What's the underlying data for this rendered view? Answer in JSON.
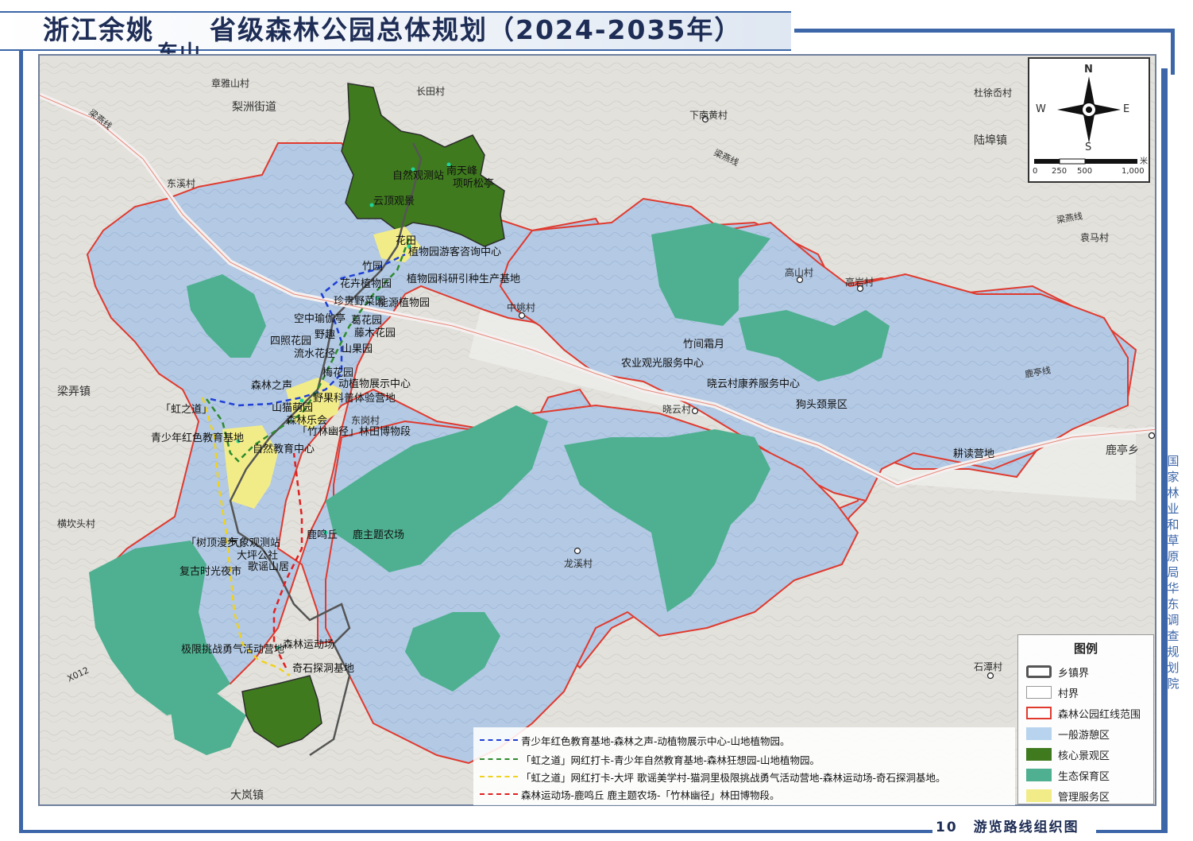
{
  "title": {
    "main": "浙江余姚",
    "special_char": "東",
    "special_sub": "东山",
    "rest": "省级森林公园总体规划（2024-2035年）"
  },
  "footer": {
    "page": "10",
    "label": "游览路线组织图"
  },
  "side_text": "国家林业和草原局华东调查规划院",
  "compass": {
    "n": "N",
    "s": "S",
    "e": "E",
    "w": "W",
    "unit": "米",
    "ticks": [
      "0",
      "250",
      "500",
      "1,000"
    ]
  },
  "legend": {
    "title": "图例",
    "items": [
      {
        "label": "乡镇界",
        "color": "#555555"
      },
      {
        "label": "村界",
        "color": "#999999"
      },
      {
        "label": "森林公园红线范围",
        "color": "#e03a2e"
      },
      {
        "label": "一般游憩区",
        "color": "#b7d3ee"
      },
      {
        "label": "核心景观区",
        "color": "#3f7a1e"
      },
      {
        "label": "生态保育区",
        "color": "#4eb090"
      },
      {
        "label": "管理服务区",
        "color": "#f2ec88"
      }
    ]
  },
  "routes": [
    {
      "text": "青少年红色教育基地-森林之声-动植物展示中心-山地植物园。",
      "color": "#1f3fd6"
    },
    {
      "text": "「虹之道」网红打卡-青少年自然教育基地-森林狂想园-山地植物园。",
      "color": "#2e8b2e"
    },
    {
      "text": "「虹之道」网红打卡-大坪 歌谣美学村-猫洞里极限挑战勇气活动营地-森林运动场-奇石探洞基地。",
      "color": "#f0d21c"
    },
    {
      "text": "森林运动场-鹿鸣丘 鹿主题农场-「竹林幽径」林田博物段。",
      "color": "#e02020"
    }
  ],
  "places": {
    "zhangyashan": "章雅山村",
    "lizhou": "梨洲街道",
    "changtian": "长田村",
    "xiananhuang": "下南黄村",
    "duxu": "杜徐岙村",
    "luobu": "陆埠镇",
    "dongxi": "东溪村",
    "yuanma": "袁马村",
    "gaoshan": "高山村",
    "gaoyan": "高岩村",
    "zhongyao": "中姚村",
    "liangnong": "梁弄镇",
    "xiaoyun": "晓云村",
    "dongling": "东岗村",
    "luting": "鹿亭乡",
    "hengkan": "横坎头村",
    "longxi": "龙溪村",
    "shitan": "石潭村",
    "dalan": "大岚镇"
  },
  "spots": {
    "s1": "自然观测站",
    "s2": "南天峰",
    "s3": "项听松亭",
    "s4": "云顶观景",
    "s5": "花田",
    "s6": "植物园游客咨询中心",
    "s7": "竹园",
    "s8": "花卉植物园",
    "s9": "植物园科研引种生产基地",
    "s10": "珍贵野菜园",
    "s11": "能源植物园",
    "s12": "空中瑜伽亭",
    "s13": "葛花园",
    "s14": "四照花园",
    "s15": "野趣",
    "s16": "藤木花园",
    "s17": "流水花径",
    "s18": "山果园",
    "s19": "森林之声",
    "s20": "梅花园",
    "s21": "动植物展示中心",
    "s22": "野果科普体验营地",
    "s23": "「虹之道」",
    "s24": "山猫萌园",
    "s25": "森林乐会",
    "s26": "「竹林幽径」林田博物段",
    "s27": "青少年红色教育基地",
    "s28": "自然教育中心",
    "s29": "竹间霜月",
    "s30": "农业观光服务中心",
    "s31": "晓云村康养服务中心",
    "s32": "狗头颈景区",
    "s33": "耕读营地",
    "s34": "鹿鸣丘",
    "s35": "鹿主题农场",
    "s36": "「树顶漫步」",
    "s37": "气象观测站",
    "s38": "大坪公社",
    "s39": "复古时光夜市",
    "s40": "歌谣山居",
    "s41": "极限挑战勇气活动营地",
    "s42": "森林运动场",
    "s43": "奇石探洞基地"
  },
  "roads": {
    "r1": "梁燕线",
    "r2": "梁燕线",
    "r3": "梁燕线",
    "r4": "X012",
    "r5": "鹿亭线"
  }
}
